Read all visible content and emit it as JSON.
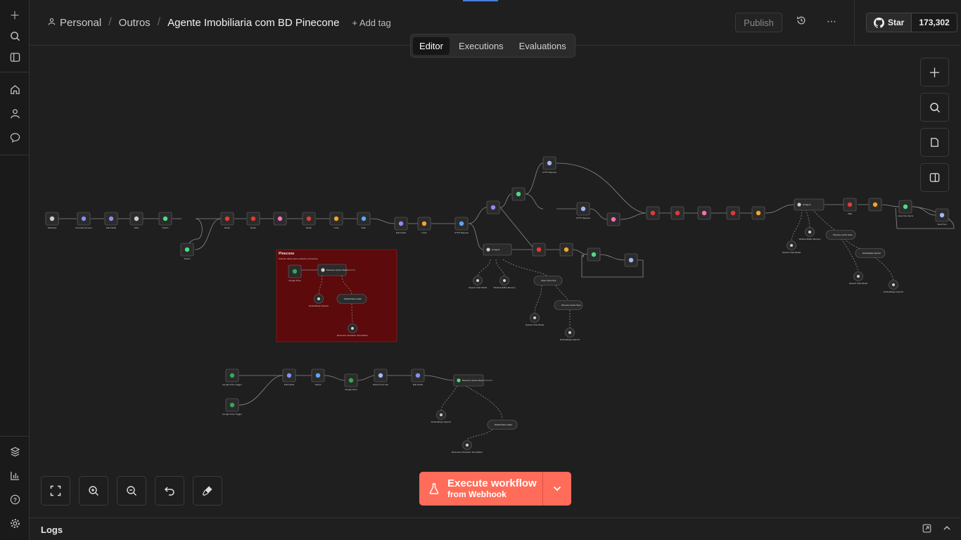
{
  "breadcrumb": {
    "project": "Personal",
    "folder": "Outros",
    "workflow": "Agente Imobiliaria com BD Pinecone",
    "add_tag": "+ Add tag"
  },
  "header": {
    "publish": "Publish",
    "github_star": "Star",
    "github_count": "173,302"
  },
  "tabs": [
    "Editor",
    "Executions",
    "Evaluations"
  ],
  "execute": {
    "line1": "Execute workflow",
    "line2": "from Webhook"
  },
  "logs": {
    "label": "Logs"
  },
  "sticky": {
    "title": "Pinecone",
    "subtitle": "Subindo dados para a tabela no Pinecone"
  },
  "nodes": {
    "webhook": "Webhook",
    "formatar": "Formatar Numero",
    "setfields": "Edit Fields",
    "filter1": "Filter",
    "switch": "Switch",
    "redis1": "Redis",
    "redis2": "Redis",
    "redis3": "Redis",
    "code1": "Code",
    "filter2": "Filter",
    "set2": "Edit Fields",
    "json1": "Code",
    "http1": "HTTP Request",
    "agent1": "AI Agent",
    "openai": "OpenAI Chat Model",
    "memory": "Window Buffer Memory",
    "vstore": "Pinecone Vector Store",
    "tool_vs": "Vector Store Tool",
    "openai2": "OpenAI Chat Model",
    "embed": "Embeddings OpenAI",
    "gdrive": "Google Drive",
    "pinecone": "Pinecone Vector Store",
    "emb2": "Embeddings OpenAI",
    "loader": "Default Data Loader",
    "splitter": "Recursive Character Text Splitter",
    "trig1": "Google Drive Trigger",
    "trig2": "Google Drive Trigger",
    "t_edit": "Edit Fields",
    "t_switch": "Switch",
    "t_gdrive": "Google Drive",
    "t_extract": "Extract from File",
    "t_set": "Edit Fields",
    "t_pine": "Pinecone Vector Store",
    "t_emb": "Embeddings OpenAI",
    "t_loader": "Default Data Loader",
    "t_split": "Recursive Character Text Splitter",
    "agent2": "AI Agent",
    "memory2": "Window Buffer Memory",
    "vs2": "Pinecone Vector Store",
    "openai3": "OpenAI Chat Model",
    "emb3": "Embeddings OpenAI",
    "http2": "HTTP Request",
    "http3": "HTTP Request",
    "loop": "Loop Over Items",
    "send": "Send Text",
    "wait": "Wait"
  },
  "colors": {
    "accent": "#ff6d5a",
    "sticky": "#5c0a0c",
    "node_bg": "#2b2b2b",
    "edge": "#8a8a8a"
  }
}
